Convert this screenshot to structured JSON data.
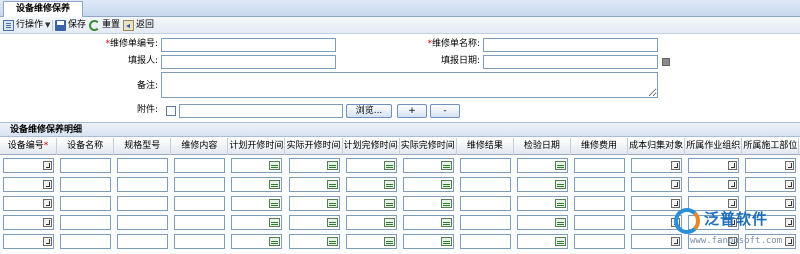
{
  "tab": {
    "title": "设备维修保养"
  },
  "toolbar": {
    "ops_label": "行操作",
    "save_label": "保存",
    "reset_label": "重置",
    "back_label": "返回"
  },
  "form": {
    "repair_no_label": "维修单编号:",
    "repair_name_label": "维修单名称:",
    "reporter_label": "填报人:",
    "report_date_label": "填报日期:",
    "remark_label": "备注:",
    "attachment_label": "附件:",
    "browse_label": "浏览...",
    "add_label": "+",
    "remove_label": "-"
  },
  "detail": {
    "title": "设备维修保养明细",
    "columns": [
      "设备编号",
      "设备名称",
      "规格型号",
      "维修内容",
      "计划开修时间",
      "实际开修时间",
      "计划完修时间",
      "实际完修时间",
      "维修结果",
      "检验日期",
      "维修费用",
      "成本归集对象",
      "所属作业组织",
      "所属施工部位"
    ],
    "column_types": [
      "lookup",
      "text",
      "text",
      "text",
      "date",
      "date",
      "date",
      "date",
      "text",
      "date",
      "text",
      "lookup",
      "lookup",
      "lookup"
    ],
    "row_count": 5
  },
  "watermark": {
    "brand": "泛普软件",
    "url": "www.fanpusoft.com"
  }
}
